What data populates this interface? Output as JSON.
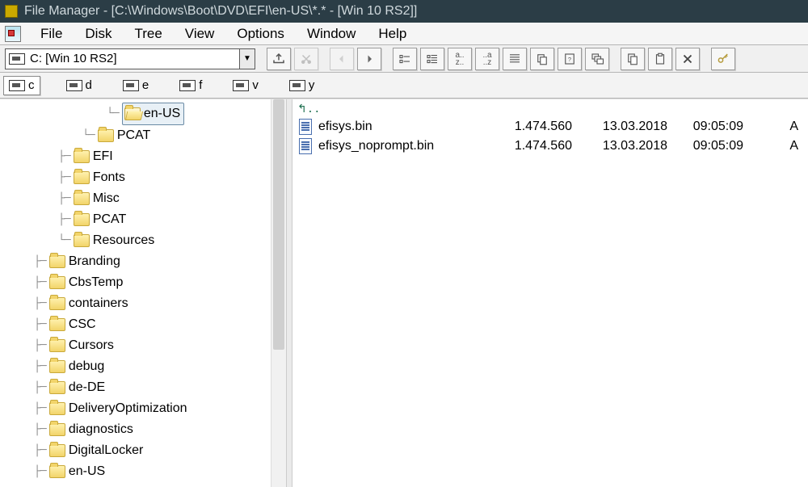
{
  "title": "File Manager - [C:\\Windows\\Boot\\DVD\\EFI\\en-US\\*.* - [Win 10 RS2]]",
  "menu": [
    "File",
    "Disk",
    "Tree",
    "View",
    "Options",
    "Window",
    "Help"
  ],
  "drive_combo": "C: [Win 10 RS2]",
  "drive_tabs": [
    {
      "letter": "c",
      "active": true
    },
    {
      "letter": "d",
      "active": false
    },
    {
      "letter": "e",
      "active": false
    },
    {
      "letter": "f",
      "active": false
    },
    {
      "letter": "v",
      "active": false
    },
    {
      "letter": "y",
      "active": false
    }
  ],
  "tree": {
    "selected_label": "en-US",
    "top_nested": [
      "en-US",
      "PCAT"
    ],
    "boot_siblings": [
      "EFI",
      "Fonts",
      "Misc",
      "PCAT",
      "Resources"
    ],
    "windows_children": [
      "Branding",
      "CbsTemp",
      "containers",
      "CSC",
      "Cursors",
      "debug",
      "de-DE",
      "DeliveryOptimization",
      "diagnostics",
      "DigitalLocker",
      "en-US"
    ]
  },
  "files": [
    {
      "name": "efisys.bin",
      "size": "1.474.560",
      "date": "13.03.2018",
      "time": "09:05:09",
      "attr": "A"
    },
    {
      "name": "efisys_noprompt.bin",
      "size": "1.474.560",
      "date": "13.03.2018",
      "time": "09:05:09",
      "attr": "A"
    }
  ],
  "toolbar_icons": [
    "share-icon",
    "cut-icon",
    "back-icon",
    "forward-icon",
    "sort-name-icon",
    "sort-type-icon",
    "sort-az-icon",
    "sort-za-icon",
    "details-icon",
    "copy-x-icon",
    "props-icon",
    "cascade-icon",
    "copy-icon",
    "paste-icon",
    "delete-icon",
    "key-icon"
  ]
}
